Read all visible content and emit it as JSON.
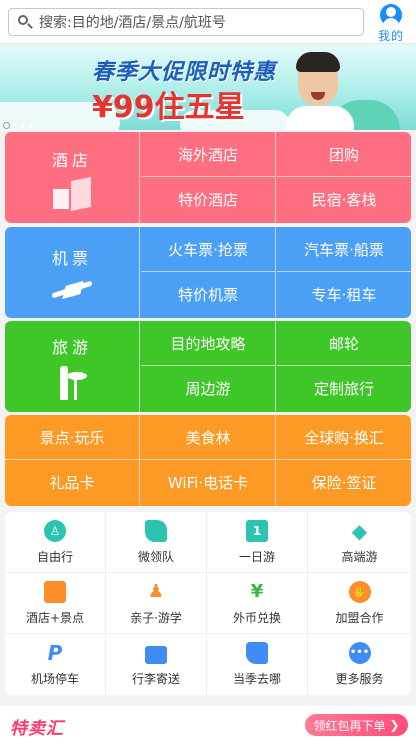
{
  "header": {
    "search_placeholder": "搜索:目的地/酒店/景点/航班号",
    "mine_label": "我的"
  },
  "banner": {
    "headline": "春季大促限时特惠",
    "price_text": "¥99住五星",
    "slide_count": 4,
    "active_slide": 1
  },
  "colors": {
    "hotel": "#fe6f81",
    "flight": "#4ba0f5",
    "travel": "#3fc729",
    "more": "#fd9a26",
    "accent": "#1a8cff",
    "promo": "#ff3a6b"
  },
  "categories": {
    "hotel": {
      "main": "酒店",
      "icon": "building-icon",
      "items": [
        "海外酒店",
        "团购",
        "特价酒店",
        "民宿·客栈"
      ]
    },
    "flight": {
      "main": "机票",
      "icon": "plane-icon",
      "items": [
        "火车票·抢票",
        "汽车票·船票",
        "特价机票",
        "专车·租车"
      ]
    },
    "travel": {
      "main": "旅游",
      "icon": "statue-of-liberty-icon",
      "items": [
        "目的地攻略",
        "邮轮",
        "周边游",
        "定制旅行"
      ]
    },
    "more": {
      "items": [
        "景点·玩乐",
        "美食林",
        "全球购·换汇",
        "礼品卡",
        "WiFi·电话卡",
        "保险·签证"
      ]
    }
  },
  "services": [
    {
      "label": "自由行",
      "icon": "walker-icon",
      "color": "#2cc3b1"
    },
    {
      "label": "微领队",
      "icon": "flag-icon",
      "color": "#2cc3b1"
    },
    {
      "label": "一日游",
      "icon": "day-tour-icon",
      "color": "#2cc3b1"
    },
    {
      "label": "高端游",
      "icon": "diamond-icon",
      "color": "#2cc3b1"
    },
    {
      "label": "酒店+景点",
      "icon": "hotel-scenic-icon",
      "color": "#fd8c2a"
    },
    {
      "label": "亲子·游学",
      "icon": "family-icon",
      "color": "#fd8c2a"
    },
    {
      "label": "外币兑换",
      "icon": "yen-icon",
      "color": "#3fb33b"
    },
    {
      "label": "加盟合作",
      "icon": "handshake-icon",
      "color": "#fd8c2a"
    },
    {
      "label": "机场停车",
      "icon": "parking-icon",
      "color": "#3f8cf5"
    },
    {
      "label": "行李寄送",
      "icon": "luggage-icon",
      "color": "#3f8cf5"
    },
    {
      "label": "当季去哪",
      "icon": "thumbs-up-icon",
      "color": "#3f8cf5"
    },
    {
      "label": "更多服务",
      "icon": "more-dots-icon",
      "color": "#3f8cf5"
    }
  ],
  "bottom": {
    "brand": "特卖汇",
    "cta": "领红包再下单",
    "cta_icon": "chevron-right-icon"
  }
}
